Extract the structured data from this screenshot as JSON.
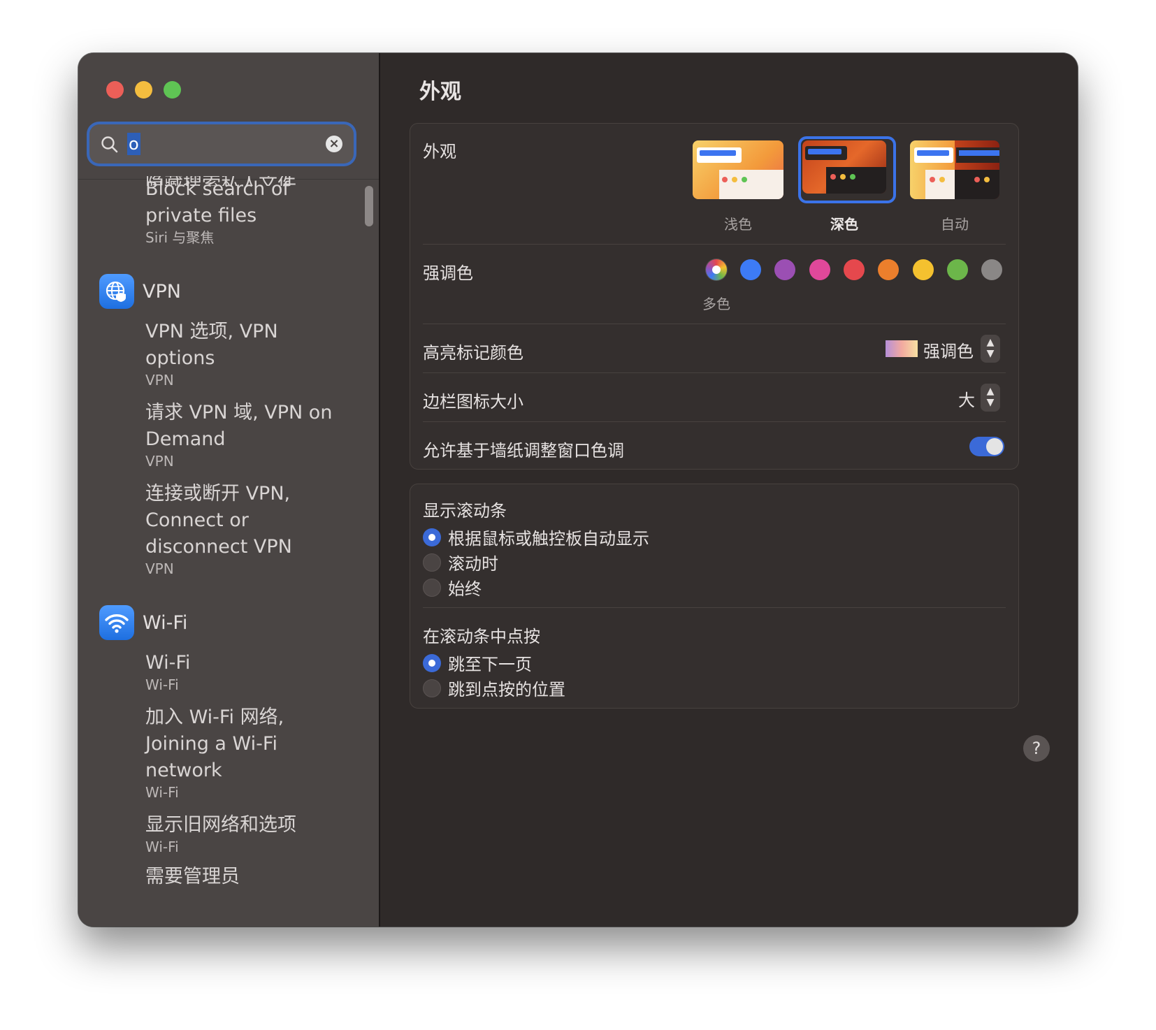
{
  "window": {
    "traffic_lights": {
      "close": "#ec5f58",
      "minimize": "#f4bd3f",
      "zoom": "#5fc454"
    }
  },
  "sidebar": {
    "search": {
      "value": "o",
      "icon": "search-icon",
      "clear_icon": "clear-icon"
    },
    "results": [
      {
        "partial_title": "隐藏搜索私人文件,",
        "items": [
          {
            "title": "Block search of private files",
            "subtitle": "Siri 与聚焦"
          }
        ]
      },
      {
        "category": "VPN",
        "icon": "vpn-globe-icon",
        "items": [
          {
            "title": "VPN 选项, VPN options",
            "subtitle": "VPN"
          },
          {
            "title": "请求 VPN 域, VPN on Demand",
            "subtitle": "VPN"
          },
          {
            "title": "连接或断开 VPN, Connect or disconnect VPN",
            "subtitle": "VPN"
          }
        ]
      },
      {
        "category": "Wi-Fi",
        "icon": "wifi-icon",
        "items": [
          {
            "title": "Wi-Fi",
            "subtitle": "Wi-Fi"
          },
          {
            "title": "加入 Wi-Fi 网络, Joining a Wi-Fi network",
            "subtitle": "Wi-Fi"
          },
          {
            "title": "显示旧网络和选项",
            "subtitle": "Wi-Fi"
          }
        ],
        "trailing_partial": "需要管理员"
      }
    ]
  },
  "main": {
    "title": "外观",
    "appearance": {
      "label": "外观",
      "options": [
        {
          "label": "浅色",
          "selected": false
        },
        {
          "label": "深色",
          "selected": true
        },
        {
          "label": "自动",
          "selected": false
        }
      ]
    },
    "accent": {
      "label": "强调色",
      "selected_caption": "多色",
      "colors": [
        "multicolor",
        "#3d7bf6",
        "#9b4fb3",
        "#e0489a",
        "#e5484d",
        "#ec7f2c",
        "#f4c12f",
        "#6cb64a",
        "#8a8786"
      ]
    },
    "highlight": {
      "label": "高亮标记颜色",
      "value": "强调色"
    },
    "sidebar_icon_size": {
      "label": "边栏图标大小",
      "value": "大"
    },
    "wallpaper_tint": {
      "label": "允许基于墙纸调整窗口色调",
      "enabled": true
    },
    "show_scrollbars": {
      "label": "显示滚动条",
      "options": [
        {
          "label": "根据鼠标或触控板自动显示",
          "selected": true
        },
        {
          "label": "滚动时",
          "selected": false
        },
        {
          "label": "始终",
          "selected": false
        }
      ]
    },
    "click_scrollbar": {
      "label": "在滚动条中点按",
      "options": [
        {
          "label": "跳至下一页",
          "selected": true
        },
        {
          "label": "跳到点按的位置",
          "selected": false
        }
      ]
    },
    "help_label": "?"
  }
}
